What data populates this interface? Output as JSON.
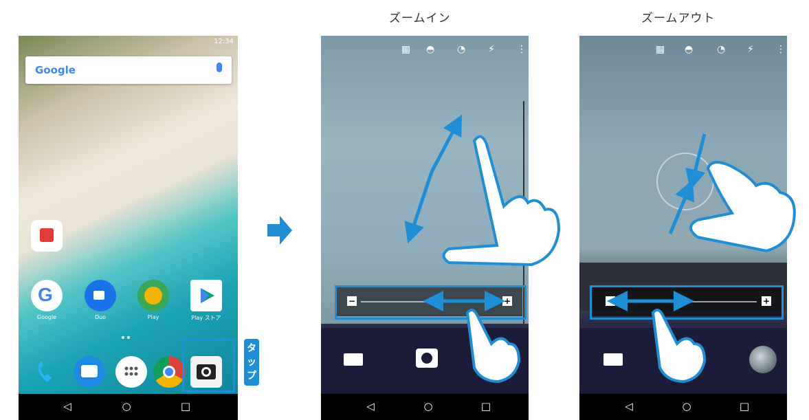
{
  "captions": {
    "zoom_in": "ズームイン",
    "zoom_out": "ズームアウト"
  },
  "phone1": {
    "status": "12:34",
    "search_logo": "Google",
    "apps": [
      {
        "label": "Google",
        "icon": "google-icon"
      },
      {
        "label": "Duo",
        "icon": "duo-icon"
      },
      {
        "label": "Play",
        "icon": "play-games-icon"
      },
      {
        "label": "Play ストア",
        "icon": "play-store-icon"
      }
    ],
    "dock": [
      "phone-icon",
      "messages-icon",
      "app-drawer-icon",
      "chrome-icon",
      "camera-icon"
    ],
    "tap_label": [
      "タ",
      "ッ",
      "プ"
    ],
    "nav": {
      "back": "◁",
      "home": "○",
      "recents": "□"
    }
  },
  "camera": {
    "zoom_minus": "−",
    "zoom_plus": "+",
    "nav": {
      "back": "◁",
      "home": "○",
      "recents": "□"
    }
  },
  "colors": {
    "accent": "#1e8fd6"
  }
}
